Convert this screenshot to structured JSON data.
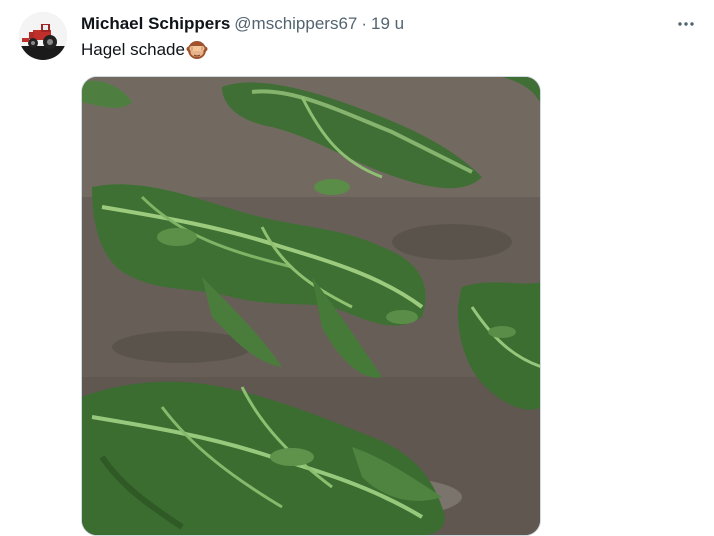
{
  "tweet": {
    "author_name": "Michael Schippers",
    "handle": "@mschippers67",
    "separator": "·",
    "time": "19 u",
    "text": "Hagel schade",
    "emoji_icon": "see-no-evil-monkey-icon",
    "more_icon": "more-horizontal-icon"
  },
  "colors": {
    "name": "#0f1419",
    "secondary": "#536471",
    "border": "#cfd9de"
  }
}
